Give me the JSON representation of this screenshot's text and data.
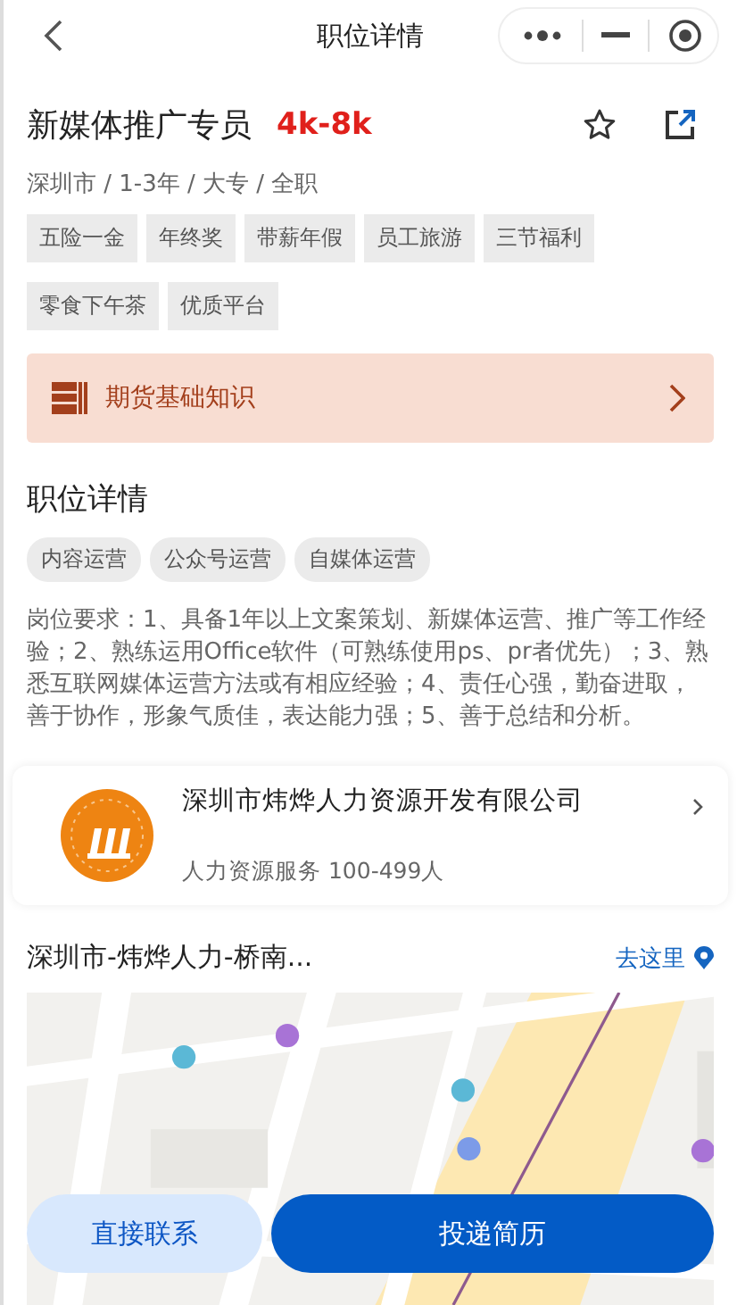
{
  "nav": {
    "title": "职位详情"
  },
  "job": {
    "title": "新媒体推广专员",
    "salary": "4k-8k",
    "favorited": false,
    "meta": "深圳市 / 1-3年 / 大专 / 全职",
    "benefits": [
      "五险一金",
      "年终奖",
      "带薪年假",
      "员工旅游",
      "三节福利",
      "零食下午茶",
      "优质平台"
    ]
  },
  "banner": {
    "label": "期货基础知识"
  },
  "details": {
    "heading": "职位详情",
    "skills": [
      "内容运营",
      "公众号运营",
      "自媒体运营"
    ],
    "description": "岗位要求：1、具备1年以上文案策划、新媒体运营、推广等工作经验；2、熟练运用Office软件（可熟练使用ps、pr者优先）；3、熟悉互联网媒体运营方法或有相应经验；4、责任心强，勤奋进取，善于协作，形象气质佳，表达能力强；5、善于总结和分析。"
  },
  "company": {
    "name": "深圳市炜烨人力资源开发有限公司",
    "info": "人力资源服务 100-499人"
  },
  "location": {
    "address": "深圳市-炜烨人力-桥南...",
    "link": "去这里"
  },
  "actions": [
    {
      "label": "直接联系",
      "primary": false
    },
    {
      "label": "投递简历",
      "primary": true
    }
  ]
}
